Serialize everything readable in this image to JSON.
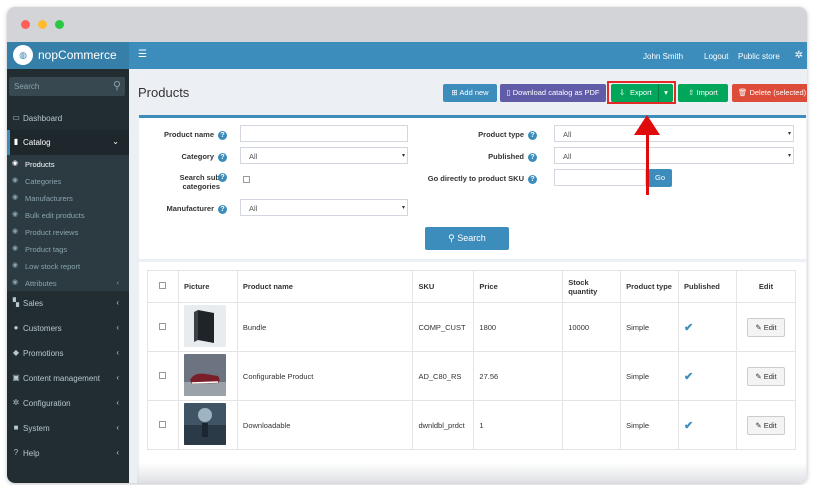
{
  "sidebar": {
    "logo_text": "nopCommerce",
    "search_placeholder": "Search",
    "items": [
      {
        "label": "Dashboard",
        "icon": "desktop-icon"
      },
      {
        "label": "Catalog",
        "icon": "book-icon"
      },
      {
        "label": "Sales",
        "icon": "cart-icon"
      },
      {
        "label": "Customers",
        "icon": "user-icon"
      },
      {
        "label": "Promotions",
        "icon": "tag-icon"
      },
      {
        "label": "Content management",
        "icon": "cubes-icon"
      },
      {
        "label": "Configuration",
        "icon": "gears-icon"
      },
      {
        "label": "System",
        "icon": "cube-icon"
      },
      {
        "label": "Help",
        "icon": "question-icon"
      }
    ],
    "catalog_sub": [
      "Products",
      "Categories",
      "Manufacturers",
      "Bulk edit products",
      "Product reviews",
      "Product tags",
      "Low stock report",
      "Attributes"
    ]
  },
  "topbar": {
    "user": "John Smith",
    "logout": "Logout",
    "public_store": "Public store"
  },
  "page": {
    "title": "Products"
  },
  "toolbar": {
    "add_new": "Add new",
    "download_pdf": "Download catalog as PDF",
    "export": "Export",
    "import": "Import",
    "delete_selected": "Delete (selected)"
  },
  "search": {
    "product_name_label": "Product name",
    "category_label": "Category",
    "category_value": "All",
    "search_sub_label_1": "Search sub",
    "search_sub_label_2": "categories",
    "manufacturer_label": "Manufacturer",
    "manufacturer_value": "All",
    "product_type_label": "Product type",
    "product_type_value": "All",
    "published_label": "Published",
    "published_value": "All",
    "sku_label": "Go directly to product SKU",
    "go_label": "Go",
    "search_button": "Search"
  },
  "grid": {
    "headers": [
      "",
      "Picture",
      "Product name",
      "SKU",
      "Price",
      "Stock quantity",
      "Product type",
      "Published",
      "Edit"
    ],
    "rows": [
      {
        "name": "Bundle",
        "sku": "COMP_CUST",
        "price": "1800",
        "stock": "10000",
        "type": "Simple",
        "edit": "Edit"
      },
      {
        "name": "Configurable Product",
        "sku": "AD_C80_RS",
        "price": "27.56",
        "stock": "",
        "type": "Simple",
        "edit": "Edit"
      },
      {
        "name": "Downloadable",
        "sku": "dwnldbl_prdct",
        "price": "1",
        "stock": "",
        "type": "Simple",
        "edit": "Edit"
      }
    ]
  },
  "colors": {
    "primary": "#3c8dbc",
    "sidebar": "#222d32",
    "export_green": "#00a65a",
    "delete_red": "#dd4b39",
    "pdf_purple": "#605ca8",
    "annotation_red": "#e00b0b"
  }
}
